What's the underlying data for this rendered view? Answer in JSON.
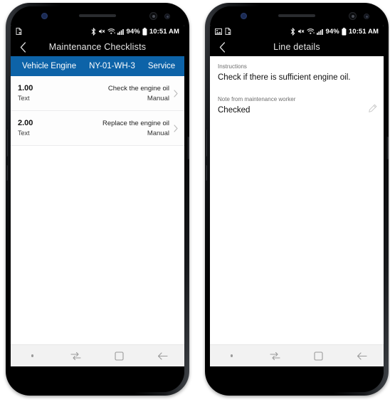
{
  "device": {
    "name": "samsung-galaxy-s8",
    "count": 2
  },
  "phones": [
    {
      "id": "phone-left",
      "status_bar": {
        "left_icons": [
          "document-error-icon"
        ],
        "icons": [
          "bluetooth-icon",
          "mute-icon",
          "wifi-icon",
          "signal-icon"
        ],
        "battery_percent": "94%",
        "battery_icon": "battery-icon",
        "time": "10:51 AM"
      },
      "app_bar": {
        "back_icon": "chevron-left-icon",
        "title": "Maintenance Checklists"
      },
      "tabs": [
        {
          "label": "Vehicle Engine",
          "active": true
        },
        {
          "label": "NY-01-WH-3",
          "active": false
        },
        {
          "label": "Service",
          "active": false
        }
      ],
      "tab_bar_color": "#0d63a8",
      "list": {
        "rows": [
          {
            "number": "1.00",
            "subtype": "Text",
            "title": "Check the engine oil",
            "meta": "Manual",
            "chevron": "chevron-right-icon"
          },
          {
            "number": "2.00",
            "subtype": "Text",
            "title": "Replace the engine oil",
            "meta": "Manual",
            "chevron": "chevron-right-icon"
          }
        ]
      },
      "nav_bar": {
        "items": [
          {
            "name": "nav-dot",
            "icon": "dot-icon"
          },
          {
            "name": "nav-recents",
            "icon": "recents-icon"
          },
          {
            "name": "nav-home",
            "icon": "home-square-icon"
          },
          {
            "name": "nav-back",
            "icon": "back-arrow-icon"
          }
        ]
      }
    },
    {
      "id": "phone-right",
      "status_bar": {
        "left_icons": [
          "image-icon",
          "document-error-icon"
        ],
        "icons": [
          "bluetooth-icon",
          "mute-icon",
          "wifi-icon",
          "signal-icon"
        ],
        "battery_percent": "94%",
        "battery_icon": "battery-icon",
        "time": "10:51 AM"
      },
      "app_bar": {
        "back_icon": "chevron-left-icon",
        "title": "Line details"
      },
      "detail": {
        "fields": [
          {
            "label": "Instructions",
            "value": "Check if there is sufficient engine oil.",
            "editable": false
          },
          {
            "label": "Note from maintenance worker",
            "value": "Checked",
            "editable": true,
            "edit_icon": "pencil-icon"
          }
        ]
      },
      "nav_bar": {
        "items": [
          {
            "name": "nav-dot",
            "icon": "dot-icon"
          },
          {
            "name": "nav-recents",
            "icon": "recents-icon"
          },
          {
            "name": "nav-home",
            "icon": "home-square-icon"
          },
          {
            "name": "nav-back",
            "icon": "back-arrow-icon"
          }
        ]
      }
    }
  ]
}
